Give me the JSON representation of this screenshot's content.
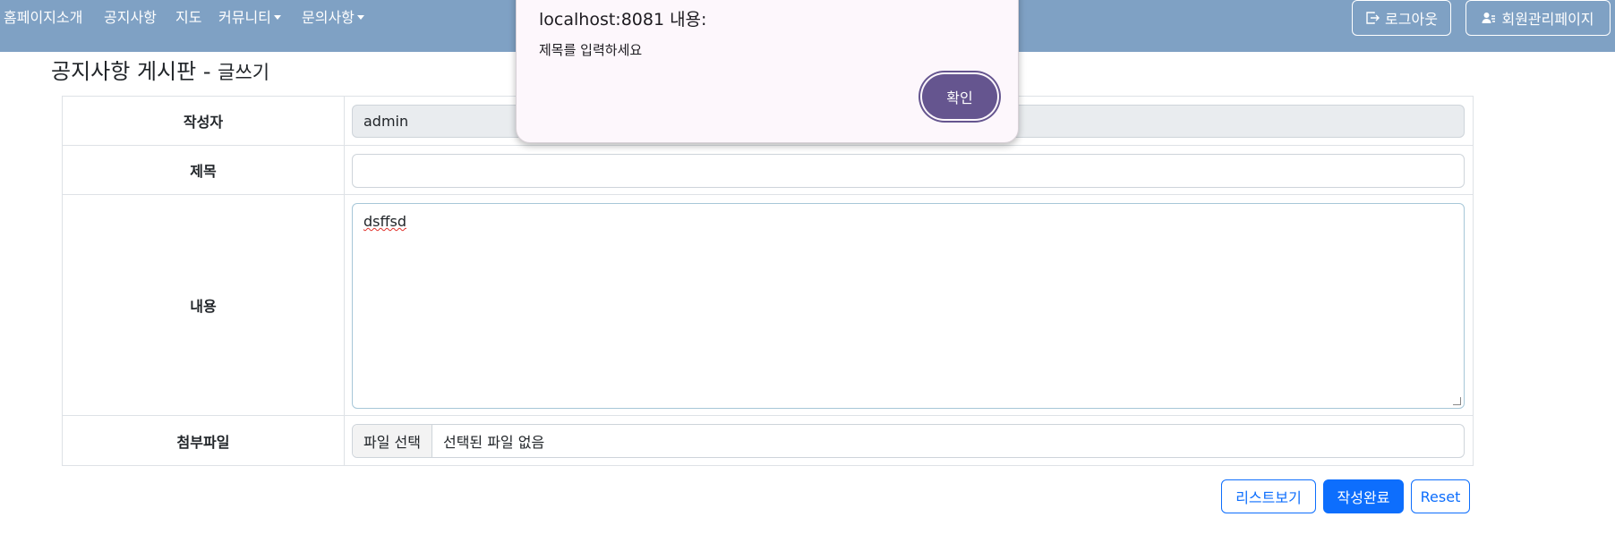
{
  "nav": {
    "items": [
      "홈페이지소개",
      "공지사항",
      "지도",
      "커뮤니티",
      "문의사항"
    ],
    "logout_label": "로그아웃",
    "member_admin_label": "회원관리페이지"
  },
  "page": {
    "title": "공지사항 게시판",
    "separator": " - ",
    "subtitle": "글쓰기"
  },
  "form": {
    "author_label": "작성자",
    "author_value": "admin",
    "title_label": "제목",
    "title_value": "",
    "content_label": "내용",
    "content_value": "dsffsd",
    "attachment_label": "첨부파일",
    "file_button_label": "파일 선택",
    "file_status": "선택된 파일 없음"
  },
  "buttons": {
    "list_label": "리스트보기",
    "submit_label": "작성완료",
    "reset_label": "Reset"
  },
  "dialog": {
    "title": "localhost:8081 내용:",
    "message": "제목를 입력하세요",
    "ok_label": "확인"
  },
  "colors": {
    "navbar": "#7fa1c4",
    "primary": "#0d6efd",
    "dialog_button": "#65558f",
    "dialog_bg": "#fdf7fc"
  }
}
